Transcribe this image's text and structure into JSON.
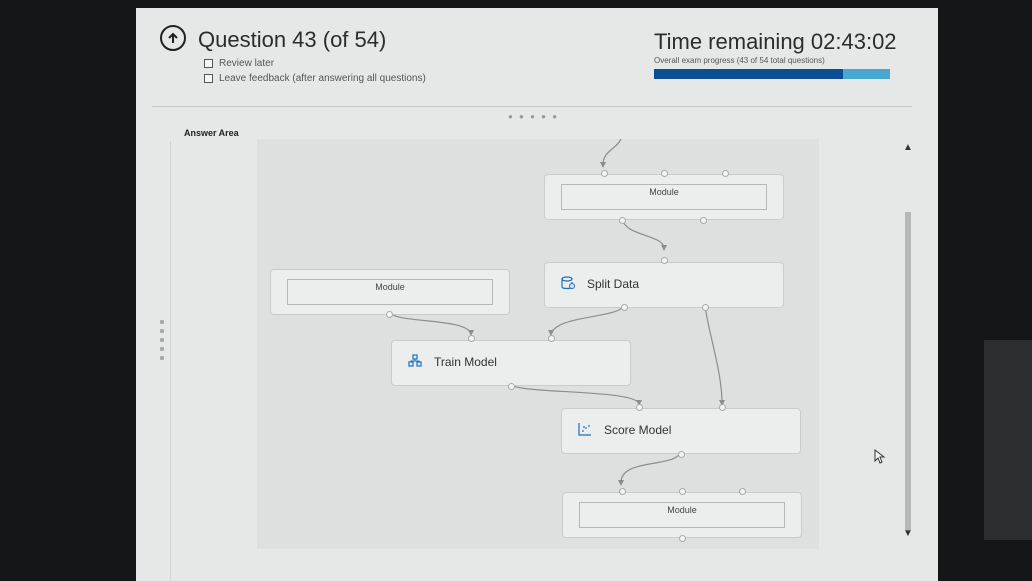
{
  "header": {
    "question_title": "Question 43 (of 54)",
    "review_later": "Review later",
    "leave_feedback": "Leave feedback (after answering all questions)",
    "time_remaining": "Time remaining 02:43:02",
    "progress_label": "Overall exam progress (43 of 54 total questions)",
    "progress_fraction": 0.8
  },
  "answer_area": {
    "label": "Answer Area",
    "modules": {
      "top_module": "Module",
      "left_module": "Module",
      "split_data": "Split Data",
      "train_model": "Train Model",
      "score_model": "Score Model",
      "bottom_module": "Module"
    }
  },
  "colors": {
    "progress_fill": "#0d4e92",
    "progress_track": "#4aa7cf",
    "icon_blue": "#1b6fc2"
  }
}
